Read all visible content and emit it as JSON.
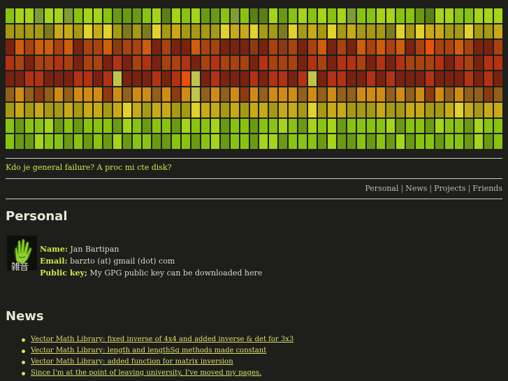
{
  "banner": {
    "palette": {
      "0": "#5a7f14",
      "1": "#6a9a11",
      "2": "#88c40f",
      "3": "#a5d418",
      "4": "#7f9d33",
      "5": "#7c7a1c",
      "6": "#a59a12",
      "7": "#c8aa16",
      "8": "#e2d22c",
      "9": "#8d3a12",
      "a": "#a9420f",
      "b": "#cf5d0a",
      "c": "#7a2210",
      "d": "#b33213",
      "e": "#e8500c",
      "f": "#d28b12",
      "g": "#92601a",
      "h": "#3d2a13",
      "i": "#54661c",
      "j": "#c1c44a"
    },
    "rows": [
      "233433423321112303231124200312323234223322103322333",
      "666657768786565867666687786658676867666586877668667",
      "cbabbabcaab9aabcaccbaaccc9ca9acabcacbababcaeaabacca",
      "dacaadacaacdcadcaadcadaaacdaaacdacddacdcdaaadcdacdd",
      "ccddcccddcdjcccdcdejcdcccdcddcdjcddccdcdcccdcccdcdc",
      "gfg9gfgfff9fgffgf9fjgfgf9fgfffgfgfggfffgfgf9fgfgg9g",
      "6767667677678767766877676776776867766676677667876776",
      "212231212221321221322312212232132312222312213221322",
      "211322121213122112212312213312221311212131221221312"
    ]
  },
  "tagline": "Kdo je general failure? A proc mi cte disk?",
  "nav": {
    "items": [
      "Personal",
      "News",
      "Projects",
      "Friends"
    ],
    "separator": "|"
  },
  "personal": {
    "heading": "Personal",
    "avatar_text": "雑音",
    "name_label": "Name:",
    "name_value": "Jan Bartipan",
    "email_label": "Email:",
    "email_value": "barzto (at) gmail (dot) com",
    "gpg_label": "Public key;",
    "gpg_text": "My GPG public key can be downloaded",
    "gpg_link": "here"
  },
  "news": {
    "heading": "News",
    "items": [
      "Vector Math Library: fixed inverse of 4x4 and added inverse & det for 3x3",
      "Vector Math Library: length and lengthSq methods made constant",
      "Vector Math Library: added function for matrix inversion",
      "Since I'm at the point of leaving university, I've moved my pages."
    ]
  }
}
